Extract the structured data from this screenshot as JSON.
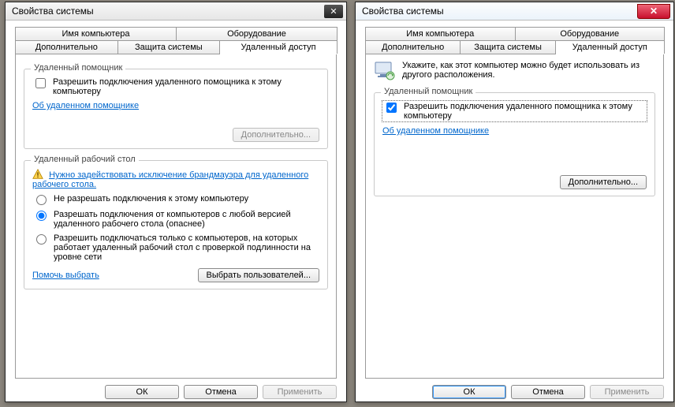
{
  "left": {
    "title": "Свойства системы",
    "tabs_row1": [
      "Имя компьютера",
      "Оборудование"
    ],
    "tabs_row2": [
      "Дополнительно",
      "Защита системы",
      "Удаленный доступ"
    ],
    "group_assistant": {
      "legend": "Удаленный помощник",
      "checkbox_label": "Разрешить подключения удаленного помощника к этому компьютеру",
      "checked": false,
      "link": "Об удаленном помощнике",
      "advanced_btn": "Дополнительно..."
    },
    "group_rdp": {
      "legend": "Удаленный рабочий стол",
      "firewall_link": "Нужно задействовать исключение брандмауэра для удаленного рабочего стола.",
      "opt1": "Не разрешать подключения к этому компьютеру",
      "opt2": "Разрешать подключения от компьютеров с любой версией удаленного рабочего стола (опаснее)",
      "opt3": "Разрешить подключаться только с компьютеров, на которых работает удаленный рабочий стол с проверкой подлинности на уровне сети",
      "help_link": "Помочь выбрать",
      "select_users_btn": "Выбрать пользователей..."
    },
    "buttons": {
      "ok": "ОК",
      "cancel": "Отмена",
      "apply": "Применить"
    }
  },
  "right": {
    "title": "Свойства системы",
    "tabs_row1": [
      "Имя компьютера",
      "Оборудование"
    ],
    "tabs_row2": [
      "Дополнительно",
      "Защита системы",
      "Удаленный доступ"
    ],
    "info_text": "Укажите, как этот компьютер можно будет использовать из другого расположения.",
    "group_assistant": {
      "legend": "Удаленный помощник",
      "checkbox_label": "Разрешить подключения удаленного помощника к этому компьютеру",
      "checked": true,
      "link": "Об удаленном помощнике",
      "advanced_btn": "Дополнительно..."
    },
    "buttons": {
      "ok": "ОК",
      "cancel": "Отмена",
      "apply": "Применить"
    }
  }
}
